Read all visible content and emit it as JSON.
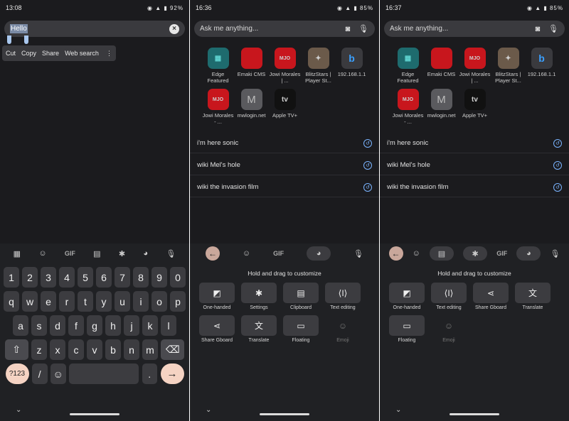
{
  "panel1": {
    "status": {
      "time": "13:08",
      "battery": "92%"
    },
    "search": {
      "text": "Hello"
    },
    "context_menu": [
      "Cut",
      "Copy",
      "Share",
      "Web search"
    ],
    "keyboard": {
      "toolbar": {
        "gif": "GIF"
      },
      "row_numbers": [
        "1",
        "2",
        "3",
        "4",
        "5",
        "6",
        "7",
        "8",
        "9",
        "0"
      ],
      "row_q": [
        "q",
        "w",
        "e",
        "r",
        "t",
        "y",
        "u",
        "i",
        "o",
        "p"
      ],
      "row_a": [
        "a",
        "s",
        "d",
        "f",
        "g",
        "h",
        "j",
        "k",
        "l"
      ],
      "row_z": [
        "z",
        "x",
        "c",
        "v",
        "b",
        "n",
        "m"
      ],
      "bottom": {
        "symbols": "?123",
        "slash": "/",
        "period": "."
      }
    }
  },
  "panel2": {
    "status": {
      "time": "16:36",
      "battery": "85%"
    },
    "search": {
      "placeholder": "Ask me anything..."
    },
    "tiles": [
      {
        "label": "Edge Featured",
        "icon": "edge-featured-icon",
        "color": "#1e6b6e"
      },
      {
        "label": "Emaki CMS",
        "icon": "emaki-cms-icon",
        "color": "#c8161d"
      },
      {
        "label": "Jowi Morales | ...",
        "icon": "jowi-icon",
        "color": "#c8161d"
      },
      {
        "label": "BlitzStars | Player St...",
        "icon": "blitzstars-icon",
        "color": "#6b5a4a"
      },
      {
        "label": "192.168.1.1",
        "icon": "bing-icon",
        "color": "#3a3a3e"
      },
      {
        "label": "Jowi Morales - ...",
        "icon": "jowi-icon",
        "color": "#c8161d"
      },
      {
        "label": "mwlogin.net",
        "icon": "m-letter-icon",
        "letter": "M",
        "color": "#5a5a5e"
      },
      {
        "label": "Apple TV+",
        "icon": "apple-tv-icon",
        "letter": "tv",
        "color": "#111111"
      }
    ],
    "suggestions": [
      "i'm here sonic",
      "wiki Mel's hole",
      "wiki the invasion film"
    ],
    "keyboard": {
      "gif": "GIF",
      "hint": "Hold and drag to customize",
      "items": [
        {
          "label": "One-handed",
          "icon": "one-handed-icon"
        },
        {
          "label": "Settings",
          "icon": "settings-icon"
        },
        {
          "label": "Clipboard",
          "icon": "clipboard-icon"
        },
        {
          "label": "Text editing",
          "icon": "text-editing-icon"
        },
        {
          "label": "Share Gboard",
          "icon": "share-icon"
        },
        {
          "label": "Translate",
          "icon": "translate-icon"
        },
        {
          "label": "Floating",
          "icon": "floating-icon"
        },
        {
          "label": "Emoji",
          "icon": "emoji-icon",
          "dim": true
        }
      ]
    }
  },
  "panel3": {
    "status": {
      "time": "16:37",
      "battery": "85%"
    },
    "search": {
      "placeholder": "Ask me anything..."
    },
    "suggestions": [
      "i'm here sonic",
      "wiki Mel's hole",
      "wiki the invasion film"
    ],
    "keyboard": {
      "gif": "GIF",
      "hint": "Hold and drag to customize",
      "items": [
        {
          "label": "One-handed",
          "icon": "one-handed-icon"
        },
        {
          "label": "Text editing",
          "icon": "text-editing-icon"
        },
        {
          "label": "Share Gboard",
          "icon": "share-icon"
        },
        {
          "label": "Translate",
          "icon": "translate-icon"
        },
        {
          "label": "Floating",
          "icon": "floating-icon"
        },
        {
          "label": "Emoji",
          "icon": "emoji-icon",
          "dim": true
        }
      ]
    }
  }
}
